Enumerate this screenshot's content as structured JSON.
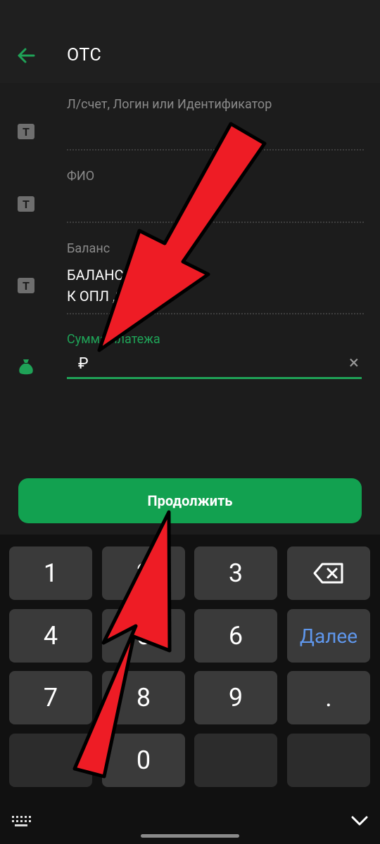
{
  "header": {
    "title": "ОТС"
  },
  "fields": [
    {
      "label": "Л/счет, Логин или Идентификатор",
      "value": ""
    },
    {
      "label": "ФИО",
      "value": ""
    },
    {
      "label": "Баланс",
      "value_line1": "БАЛАНС: РУБ.",
      "value_line2": "К ОПЛ ,00 РУБ"
    }
  ],
  "amount": {
    "label": "Сумма платежа",
    "currency_symbol": "₽"
  },
  "continue_button": {
    "label": "Продолжить"
  },
  "keyboard": {
    "keys": [
      "1",
      "2",
      "3",
      "4",
      "5",
      "6",
      "7",
      "8",
      "9",
      ".",
      "0"
    ],
    "next_label": "Далее"
  },
  "colors": {
    "accent": "#12a150",
    "link_blue": "#5f97ec",
    "arrow_red": "#ee1c25"
  },
  "icons": [
    "back-arrow-icon",
    "text-field-icon",
    "money-bag-icon",
    "clear-icon",
    "backspace-icon",
    "keyboard-icon",
    "chevron-down-icon"
  ]
}
